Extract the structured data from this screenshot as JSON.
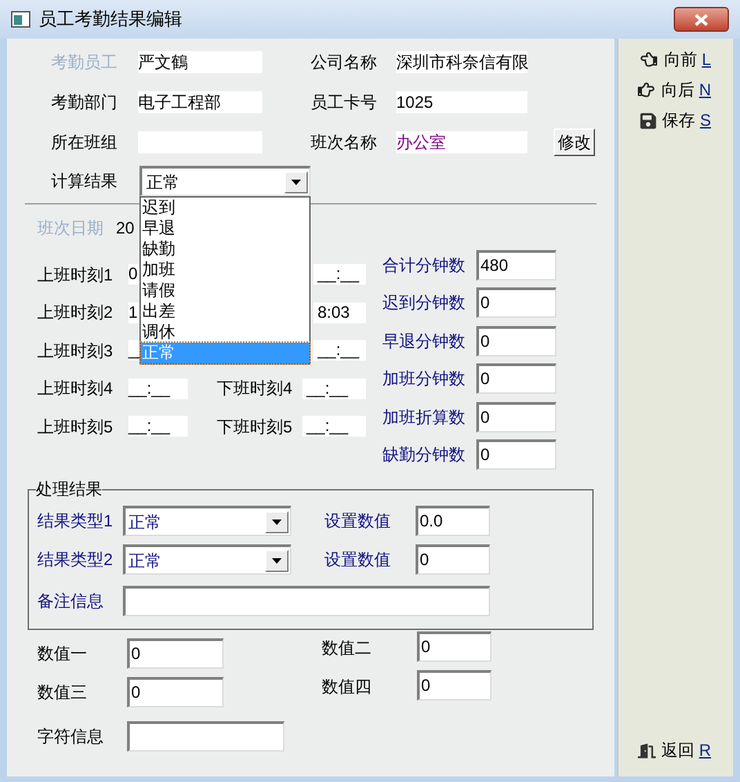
{
  "window": {
    "title": "员工考勤结果编辑"
  },
  "info_rows": [
    {
      "left": {
        "label": "考勤员工",
        "value": "严文鶴",
        "disabled": true
      },
      "right": {
        "label": "公司名称",
        "value": "深圳市科奈信有限",
        "disabled": false,
        "emphasis": false
      }
    },
    {
      "left": {
        "label": "考勤部门",
        "value": "电子工程部",
        "disabled": false
      },
      "right": {
        "label": "员工卡号",
        "value": "1025",
        "disabled": false,
        "emphasis": false
      }
    },
    {
      "left": {
        "label": "所在班组",
        "disabled": false
      },
      "right": {
        "label": "班次名称",
        "value": "办公室",
        "disabled": false,
        "emphasis": true
      },
      "button": "修改"
    }
  ],
  "calc": {
    "label": "计算结果",
    "value": "正常",
    "expanded": true,
    "options": [
      {
        "label": "迟到",
        "selected": false
      },
      {
        "label": "早退",
        "selected": false
      },
      {
        "label": "缺勤",
        "selected": false
      },
      {
        "label": "加班",
        "selected": false
      },
      {
        "label": "请假",
        "selected": false
      },
      {
        "label": "出差",
        "selected": false
      },
      {
        "label": "调休",
        "selected": false
      },
      {
        "label": "正常",
        "selected": true
      }
    ]
  },
  "shift_date": {
    "label": "班次日期",
    "value": "20",
    "disabled": true
  },
  "time_rows": [
    {
      "on_label": "上班时刻1",
      "on_value": "0",
      "off_value": "__:__"
    },
    {
      "on_label": "上班时刻2",
      "on_value": "1",
      "off_value": "8:03"
    },
    {
      "on_label": "上班时刻3",
      "on_value": "__",
      "off_value": "__:__"
    },
    {
      "on_label": "上班时刻4",
      "on_value": "__:__",
      "off_label": "下班时刻4",
      "off_value": "__:__"
    },
    {
      "on_label": "上班时刻5",
      "on_value": "__:__",
      "off_label": "下班时刻5",
      "off_value": "__:__"
    }
  ],
  "minute_fields": [
    {
      "label": "合计分钟数",
      "value": "480"
    },
    {
      "label": "迟到分钟数",
      "value": "0"
    },
    {
      "label": "早退分钟数",
      "value": "0"
    },
    {
      "label": "加班分钟数",
      "value": "0"
    },
    {
      "label": "加班折算数",
      "value": "0"
    },
    {
      "label": "缺勤分钟数",
      "value": "0"
    }
  ],
  "process": {
    "title": "处理结果",
    "result_types": [
      {
        "label": "结果类型1",
        "value": "正常",
        "set_label": "设置数值",
        "set_value": "0.0"
      },
      {
        "label": "结果类型2",
        "value": "正常",
        "set_label": "设置数值",
        "set_value": "0"
      }
    ],
    "note": {
      "label": "备注信息"
    }
  },
  "values": [
    {
      "label": "数值一",
      "value": "0"
    },
    {
      "label": "数值二",
      "value": "0"
    },
    {
      "label": "数值三",
      "value": "0"
    },
    {
      "label": "数值四",
      "value": "0"
    }
  ],
  "text_info": {
    "label": "字符信息"
  },
  "side_buttons": [
    {
      "kind": "prev",
      "label": "向前",
      "shortcut": "L"
    },
    {
      "kind": "next",
      "label": "向后",
      "shortcut": "N"
    },
    {
      "kind": "save",
      "label": "保存",
      "shortcut": "S"
    }
  ],
  "bottom_button": {
    "kind": "exit",
    "label": "返回",
    "shortcut": "R"
  }
}
